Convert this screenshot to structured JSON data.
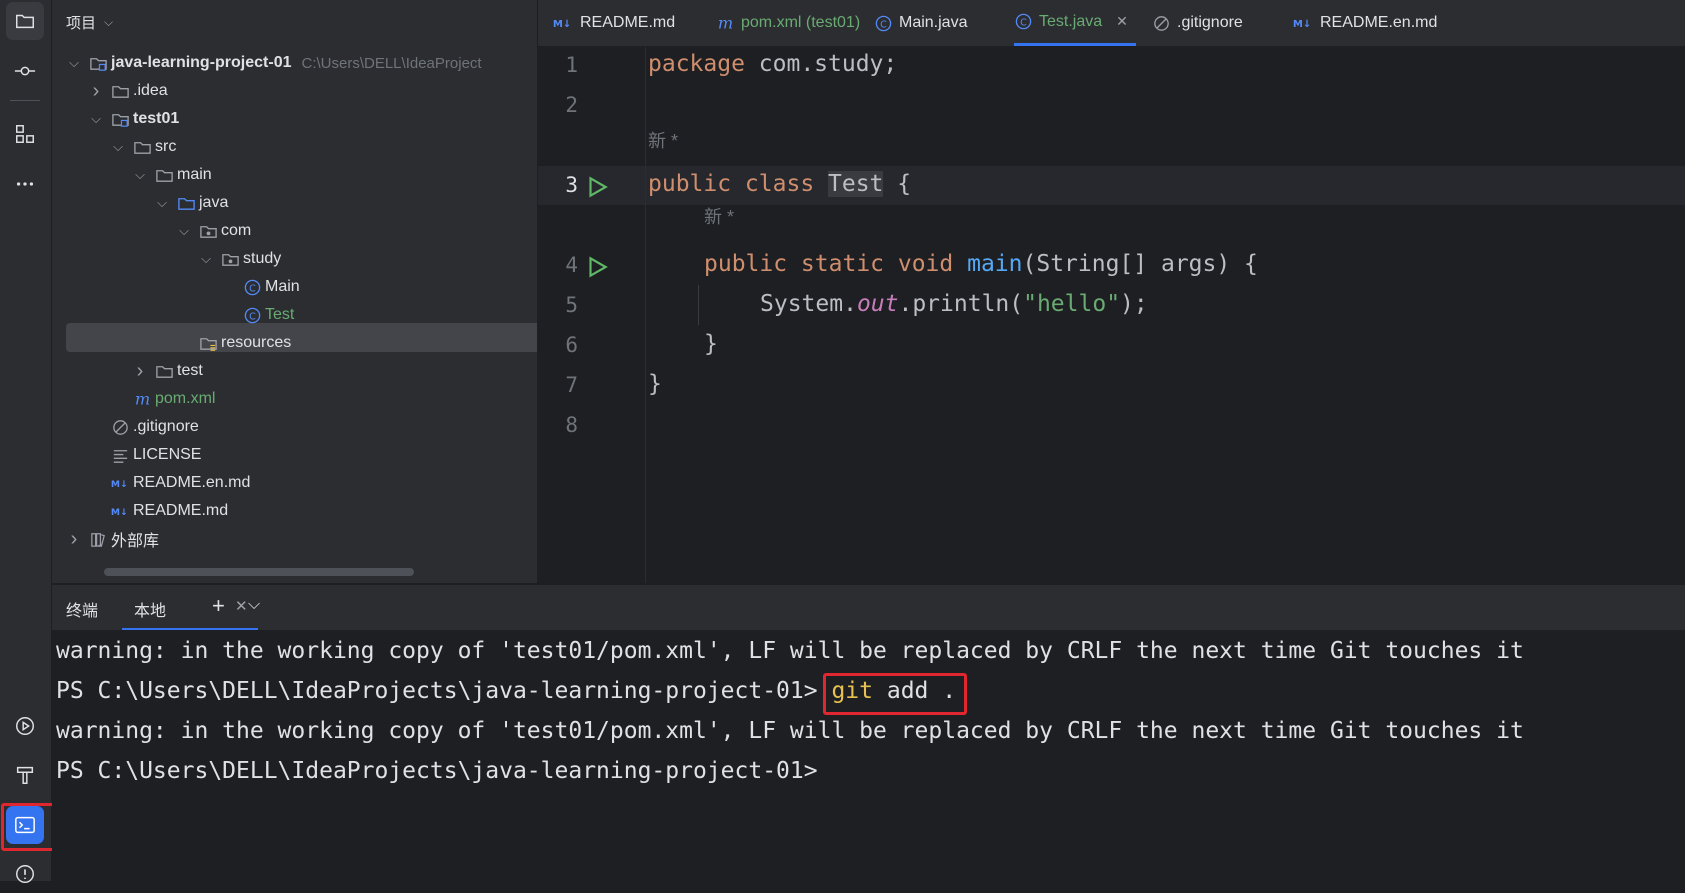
{
  "activity_bar": {
    "top_icons": [
      "folder-icon",
      "commit-icon",
      "structure-icon",
      "more-icon"
    ],
    "bottom_icons": [
      "services-icon",
      "build-icon",
      "terminal-icon",
      "problems-icon"
    ]
  },
  "project_panel": {
    "title": "项目",
    "tree": [
      {
        "label": "java-learning-project-01",
        "hint": "C:\\Users\\DELL\\IdeaProject",
        "icon": "module-folder-icon",
        "expanded": true,
        "depth": 0,
        "bold": true
      },
      {
        "label": ".idea",
        "icon": "folder-icon",
        "expanded": false,
        "depth": 1
      },
      {
        "label": "test01",
        "icon": "module-folder-icon",
        "expanded": true,
        "depth": 1,
        "bold": true
      },
      {
        "label": "src",
        "icon": "folder-icon",
        "expanded": true,
        "depth": 2
      },
      {
        "label": "main",
        "icon": "folder-icon",
        "expanded": true,
        "depth": 3
      },
      {
        "label": "java",
        "icon": "source-folder-icon",
        "expanded": true,
        "depth": 4
      },
      {
        "label": "com",
        "icon": "package-icon",
        "expanded": true,
        "depth": 5
      },
      {
        "label": "study",
        "icon": "package-icon",
        "expanded": true,
        "depth": 6
      },
      {
        "label": "Main",
        "icon": "class-icon",
        "depth": 7
      },
      {
        "label": "Test",
        "icon": "class-icon",
        "depth": 7,
        "selected": true,
        "color": "#6aab73"
      },
      {
        "label": "resources",
        "icon": "resources-folder-icon",
        "depth": 5
      },
      {
        "label": "test",
        "icon": "folder-icon",
        "expanded": false,
        "depth": 3
      },
      {
        "label": "pom.xml",
        "icon": "maven-icon",
        "depth": 2,
        "color": "#6aab73"
      },
      {
        "label": ".gitignore",
        "icon": "gitignore-icon",
        "depth": 1
      },
      {
        "label": "LICENSE",
        "icon": "text-file-icon",
        "depth": 1
      },
      {
        "label": "README.en.md",
        "icon": "markdown-icon",
        "depth": 1
      },
      {
        "label": "README.md",
        "icon": "markdown-icon",
        "depth": 1
      },
      {
        "label": "外部库",
        "icon": "library-icon",
        "expanded": false,
        "depth": 0
      }
    ]
  },
  "editor_tabs": [
    {
      "label": "README.md",
      "icon": "markdown-icon"
    },
    {
      "label": "pom.xml (test01)",
      "icon": "maven-icon",
      "color": "#6aab73"
    },
    {
      "label": "Main.java",
      "icon": "class-icon"
    },
    {
      "label": "Test.java",
      "icon": "class-icon",
      "active": true,
      "color": "#6aab73",
      "closable": true
    },
    {
      "label": ".gitignore",
      "icon": "gitignore-icon"
    },
    {
      "label": "README.en.md",
      "icon": "markdown-icon"
    }
  ],
  "editor": {
    "line_numbers": [
      "1",
      "2",
      "3",
      "4",
      "5",
      "6",
      "7",
      "8"
    ],
    "current_line": "3",
    "inlay_hint": "新 *",
    "code": {
      "l1_kw": "package",
      "l1_rest": " com.study;",
      "l3_kw": "public class ",
      "l3_cls": "Test",
      "l3_rest": " {",
      "l4_kw": "public static void ",
      "l4_fn": "main",
      "l4_rest": "(String[] args) {",
      "l5_a": "System.",
      "l5_fld": "out",
      "l5_b": ".println(",
      "l5_str": "\"hello\"",
      "l5_c": ");",
      "l6": "}",
      "l7": "}"
    }
  },
  "terminal": {
    "title": "终端",
    "tab": "本地",
    "lines": {
      "w1": "warning: in the working copy of 'test01/pom.xml', LF will be replaced by CRLF the next time Git touches it",
      "p1": "PS C:\\Users\\DELL\\IdeaProjects\\java-learning-project-01> ",
      "cmd_git": "git",
      "cmd_rest": " add .",
      "w2": "warning: in the working copy of 'test01/pom.xml', LF will be replaced by CRLF the next time Git touches it",
      "p2": "PS C:\\Users\\DELL\\IdeaProjects\\java-learning-project-01>"
    }
  },
  "colors": {
    "accent": "#3574f0",
    "highlight_box": "#e0262e",
    "keyword": "#cf8e6d",
    "string": "#6aab73",
    "function": "#56a8f5"
  }
}
